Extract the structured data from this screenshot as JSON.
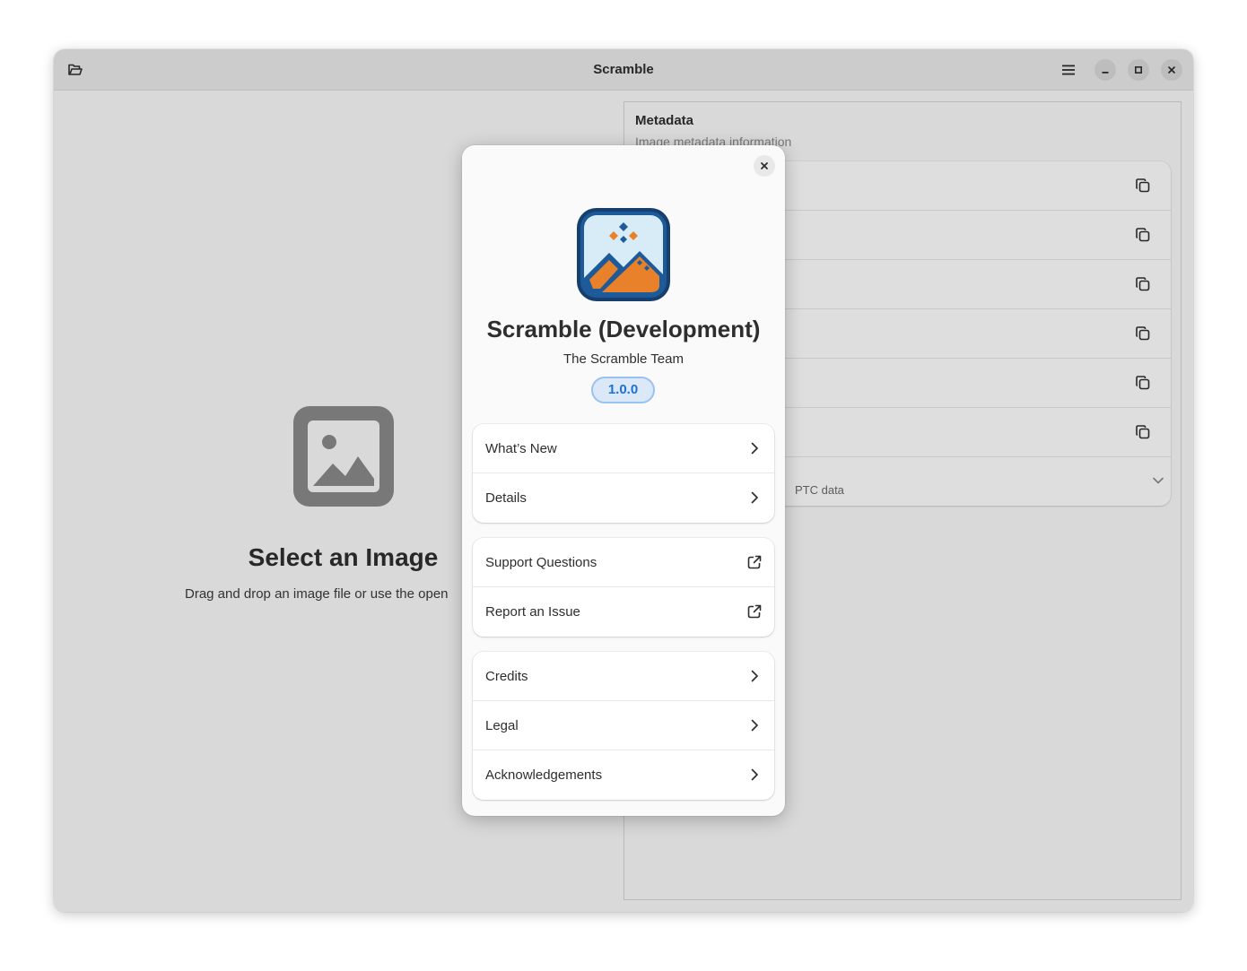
{
  "window": {
    "title": "Scramble"
  },
  "empty_state": {
    "title": "Select an Image",
    "description": "Drag and drop an image file or use the open"
  },
  "metadata": {
    "title": "Metadata",
    "subtitle": "Image metadata information",
    "rows": [
      {
        "icon": "copy-icon"
      },
      {
        "icon": "copy-icon"
      },
      {
        "icon": "copy-icon"
      },
      {
        "icon": "copy-icon"
      },
      {
        "icon": "copy-icon"
      },
      {
        "icon": "copy-icon"
      }
    ],
    "expander_subtitle_visible": "PTC data"
  },
  "about": {
    "app_name": "Scramble (Development)",
    "developer": "The Scramble Team",
    "version": "1.0.0",
    "groups": [
      [
        {
          "label": "What’s New",
          "icon": "chevron-right-icon"
        },
        {
          "label": "Details",
          "icon": "chevron-right-icon"
        }
      ],
      [
        {
          "label": "Support Questions",
          "icon": "external-link-icon"
        },
        {
          "label": "Report an Issue",
          "icon": "external-link-icon"
        }
      ],
      [
        {
          "label": "Credits",
          "icon": "chevron-right-icon"
        },
        {
          "label": "Legal",
          "icon": "chevron-right-icon"
        },
        {
          "label": "Acknowledgements",
          "icon": "chevron-right-icon"
        }
      ]
    ]
  },
  "colors": {
    "accent": "#1c71d8",
    "icon_frame": "#1a4f8b",
    "icon_sky": "#d8ecf8",
    "icon_orange": "#e8812a"
  }
}
